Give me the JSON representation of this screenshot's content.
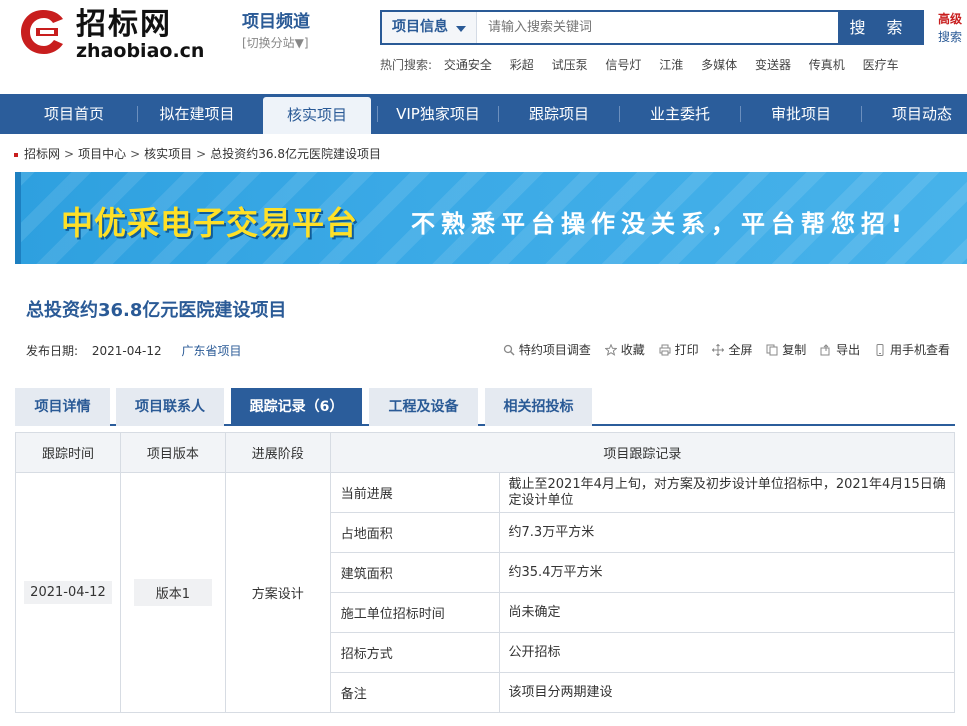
{
  "header": {
    "logo_cn": "招标网",
    "logo_en": "zhaobiao.cn",
    "channel_title": "项目频道",
    "channel_switch": "[切换分站▼]",
    "search_type": "项目信息",
    "search_placeholder": "请输入搜索关键词",
    "search_button": "搜 索",
    "advanced_1": "高级",
    "advanced_2": "搜索"
  },
  "hot_search": {
    "label": "热门搜索:",
    "items": [
      "交通安全",
      "彩超",
      "试压泵",
      "信号灯",
      "江淮",
      "多媒体",
      "变送器",
      "传真机",
      "医疗车"
    ]
  },
  "nav": {
    "items": [
      "项目首页",
      "拟在建项目",
      "核实项目",
      "VIP独家项目",
      "跟踪项目",
      "业主委托",
      "审批项目",
      "项目动态"
    ],
    "active_index": 2
  },
  "breadcrumb": [
    "招标网",
    "项目中心",
    "核实项目",
    "总投资约36.8亿元医院建设项目"
  ],
  "banner": {
    "title": "中优采电子交易平台",
    "slogan": "不熟悉平台操作没关系，平台帮您招!"
  },
  "project": {
    "title": "总投资约36.8亿元医院建设项目",
    "publish_label": "发布日期:",
    "publish_date": "2021-04-12",
    "region": "广东省项目"
  },
  "tools": [
    "特约项目调查",
    "收藏",
    "打印",
    "全屏",
    "复制",
    "导出",
    "用手机查看"
  ],
  "tabs": {
    "items": [
      "项目详情",
      "项目联系人",
      "跟踪记录（6）",
      "工程及设备",
      "相关招投标"
    ],
    "active_index": 2
  },
  "tracking_table": {
    "headers": [
      "跟踪时间",
      "项目版本",
      "进展阶段",
      "项目跟踪记录"
    ],
    "time": "2021-04-12",
    "version": "版本1",
    "stage": "方案设计",
    "records": [
      {
        "label": "当前进展",
        "value": "截止至2021年4月上旬，对方案及初步设计单位招标中，2021年4月15日确定设计单位"
      },
      {
        "label": "占地面积",
        "value": "约7.3万平方米"
      },
      {
        "label": "建筑面积",
        "value": "约35.4万平方米"
      },
      {
        "label": "施工单位招标时间",
        "value": "尚未确定"
      },
      {
        "label": "招标方式",
        "value": "公开招标"
      },
      {
        "label": "备注",
        "value": "该项目分两期建设"
      }
    ]
  },
  "colors": {
    "brand_blue": "#2b5d9b",
    "logo_red": "#c81e1e",
    "banner_yellow": "#ffe027"
  }
}
